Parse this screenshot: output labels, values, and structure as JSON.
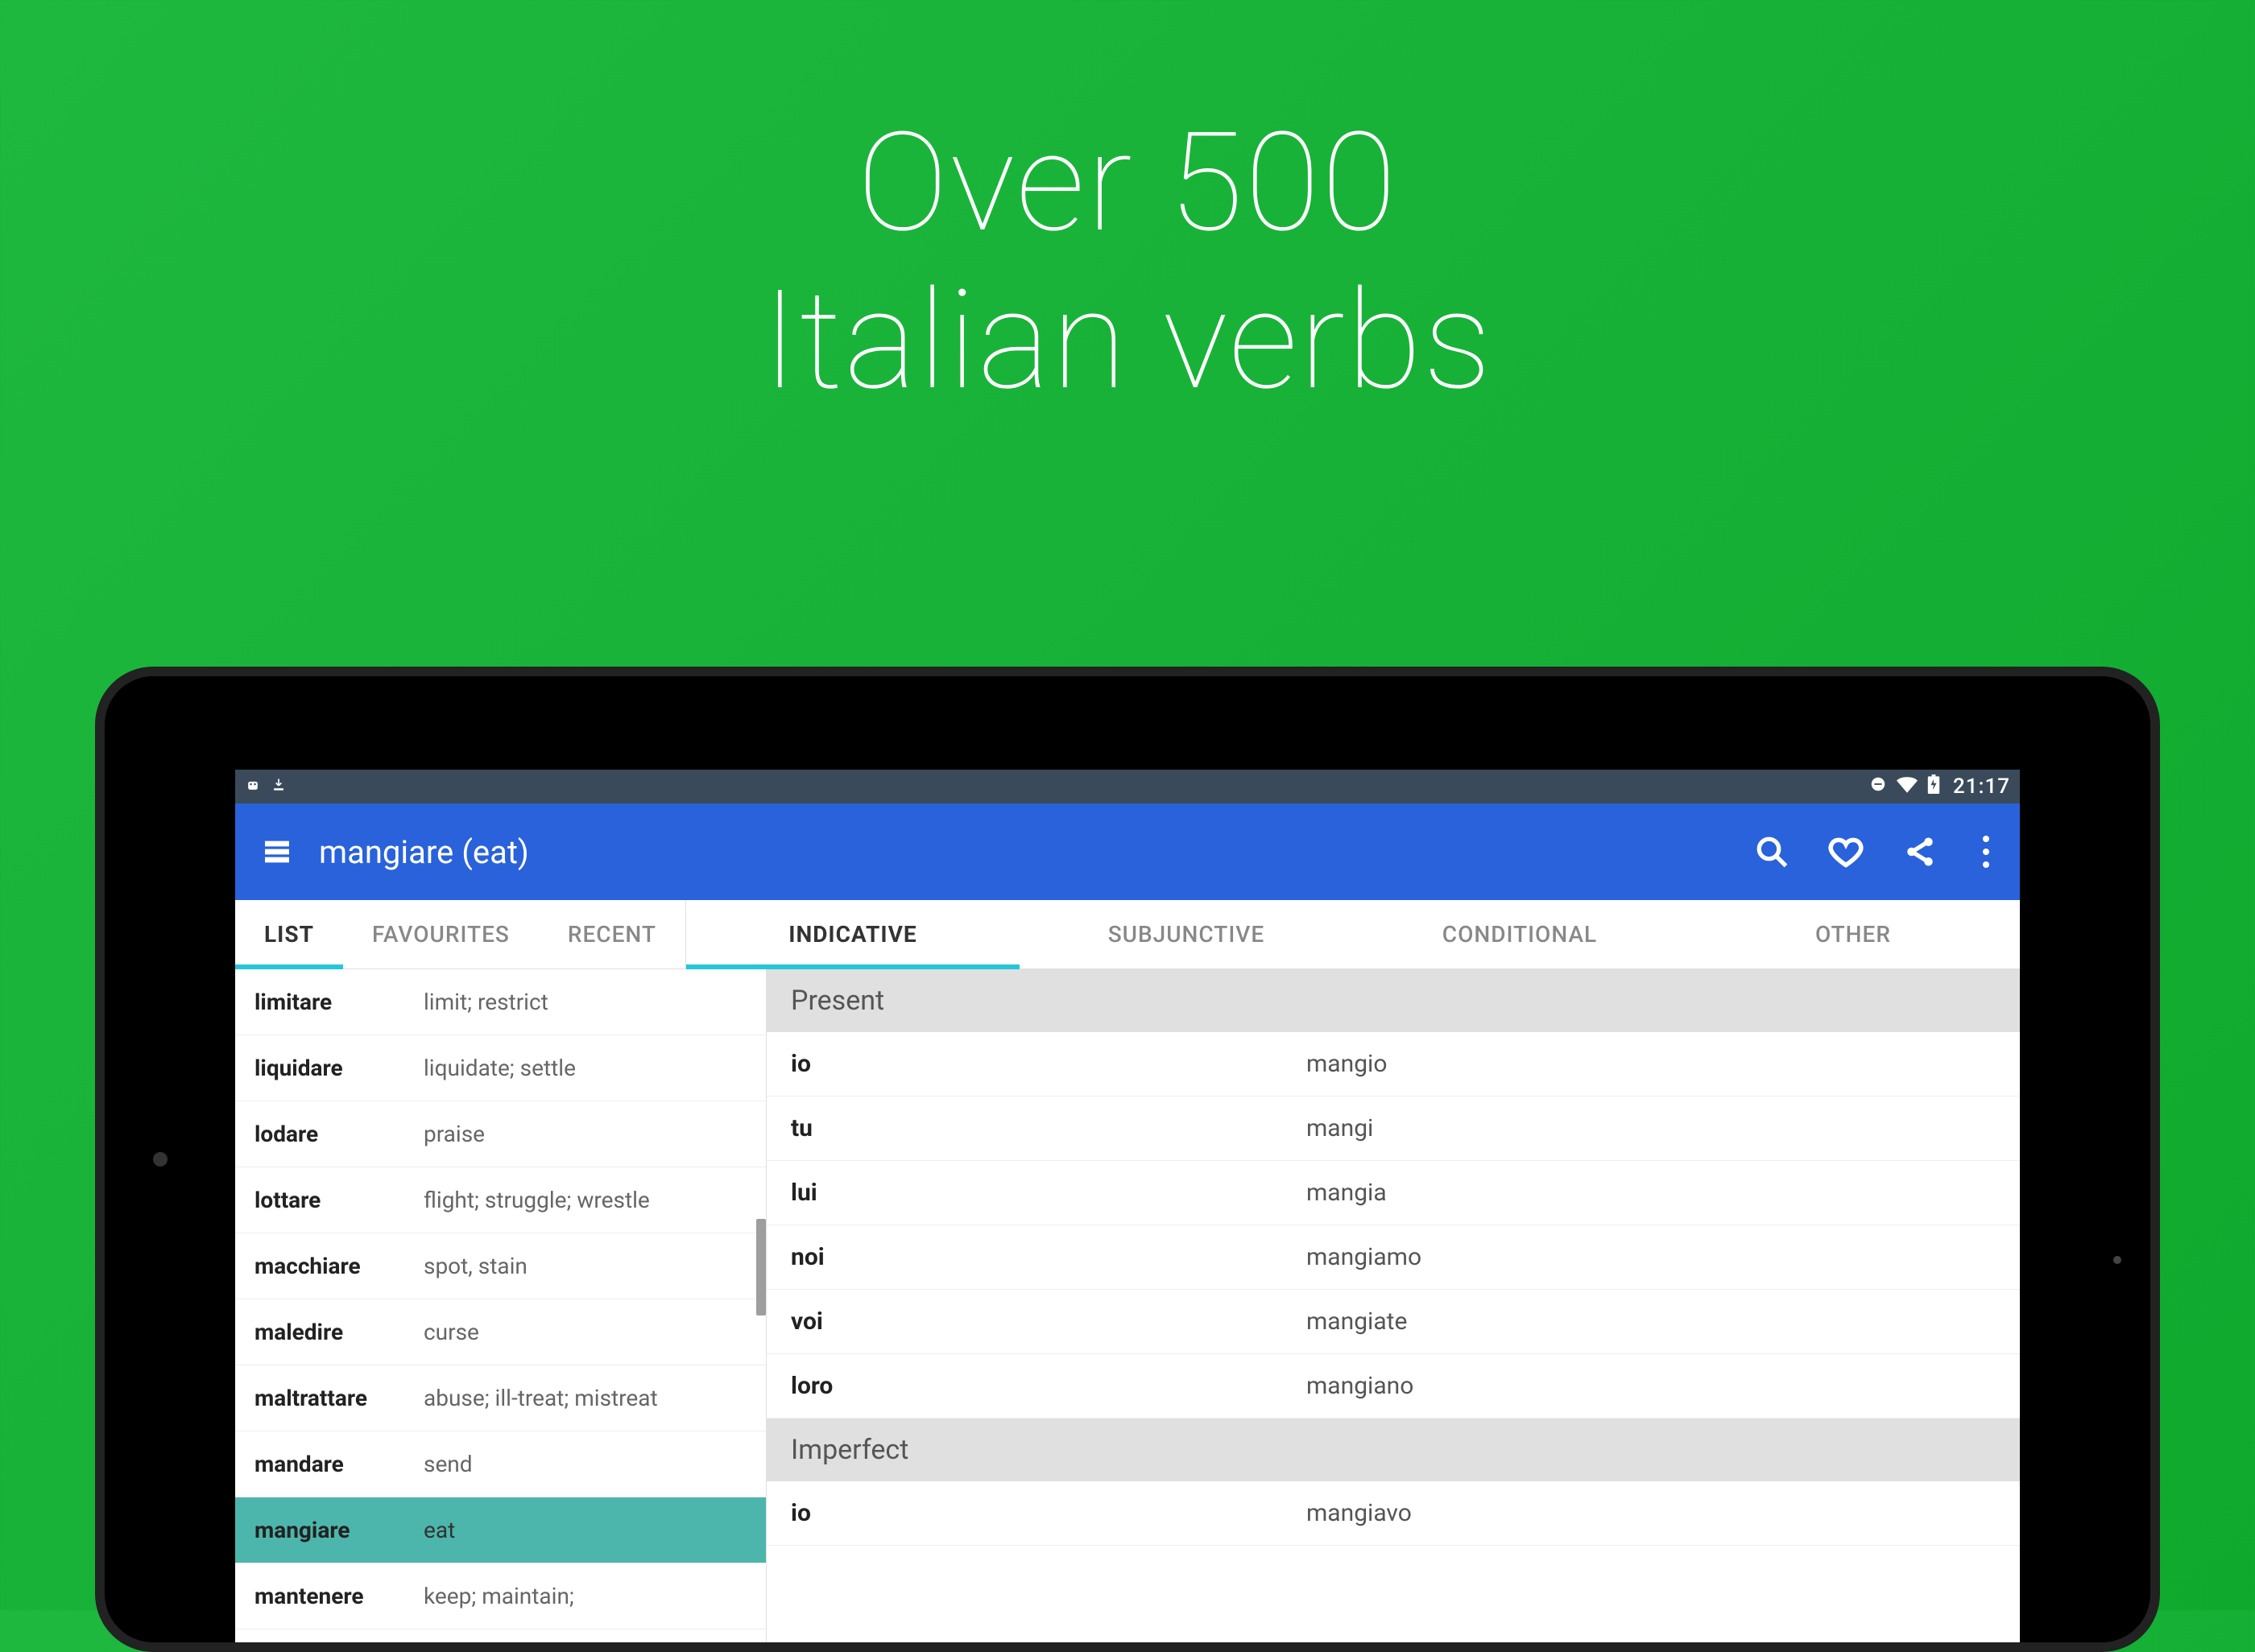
{
  "headline": {
    "line1": "Over 500",
    "line2": "Italian verbs"
  },
  "statusbar": {
    "time": "21:17"
  },
  "appbar": {
    "title": "mangiare (eat)"
  },
  "tabs": {
    "left": [
      {
        "label": "LIST",
        "active": true
      },
      {
        "label": "FAVOURITES",
        "active": false
      },
      {
        "label": "RECENT",
        "active": false
      }
    ],
    "right": [
      {
        "label": "INDICATIVE",
        "active": true
      },
      {
        "label": "SUBJUNCTIVE",
        "active": false
      },
      {
        "label": "CONDITIONAL",
        "active": false
      },
      {
        "label": "OTHER",
        "active": false
      }
    ]
  },
  "verbs": [
    {
      "verb": "limitare",
      "def": "limit; restrict"
    },
    {
      "verb": "liquidare",
      "def": "liquidate; settle"
    },
    {
      "verb": "lodare",
      "def": "praise"
    },
    {
      "verb": "lottare",
      "def": "flight; struggle; wrestle"
    },
    {
      "verb": "macchiare",
      "def": "spot, stain"
    },
    {
      "verb": "maledire",
      "def": "curse"
    },
    {
      "verb": "maltrattare",
      "def": "abuse; ill-treat; mistreat"
    },
    {
      "verb": "mandare",
      "def": "send"
    },
    {
      "verb": "mangiare",
      "def": "eat",
      "selected": true
    },
    {
      "verb": "mantenere",
      "def": "keep; maintain;"
    }
  ],
  "sections": [
    {
      "title": "Present",
      "rows": [
        {
          "pronoun": "io",
          "form": "mangio"
        },
        {
          "pronoun": "tu",
          "form": "mangi"
        },
        {
          "pronoun": "lui",
          "form": "mangia"
        },
        {
          "pronoun": "noi",
          "form": "mangiamo"
        },
        {
          "pronoun": "voi",
          "form": "mangiate"
        },
        {
          "pronoun": "loro",
          "form": "mangiano"
        }
      ]
    },
    {
      "title": "Imperfect",
      "rows": [
        {
          "pronoun": "io",
          "form": "mangiavo"
        }
      ]
    }
  ]
}
